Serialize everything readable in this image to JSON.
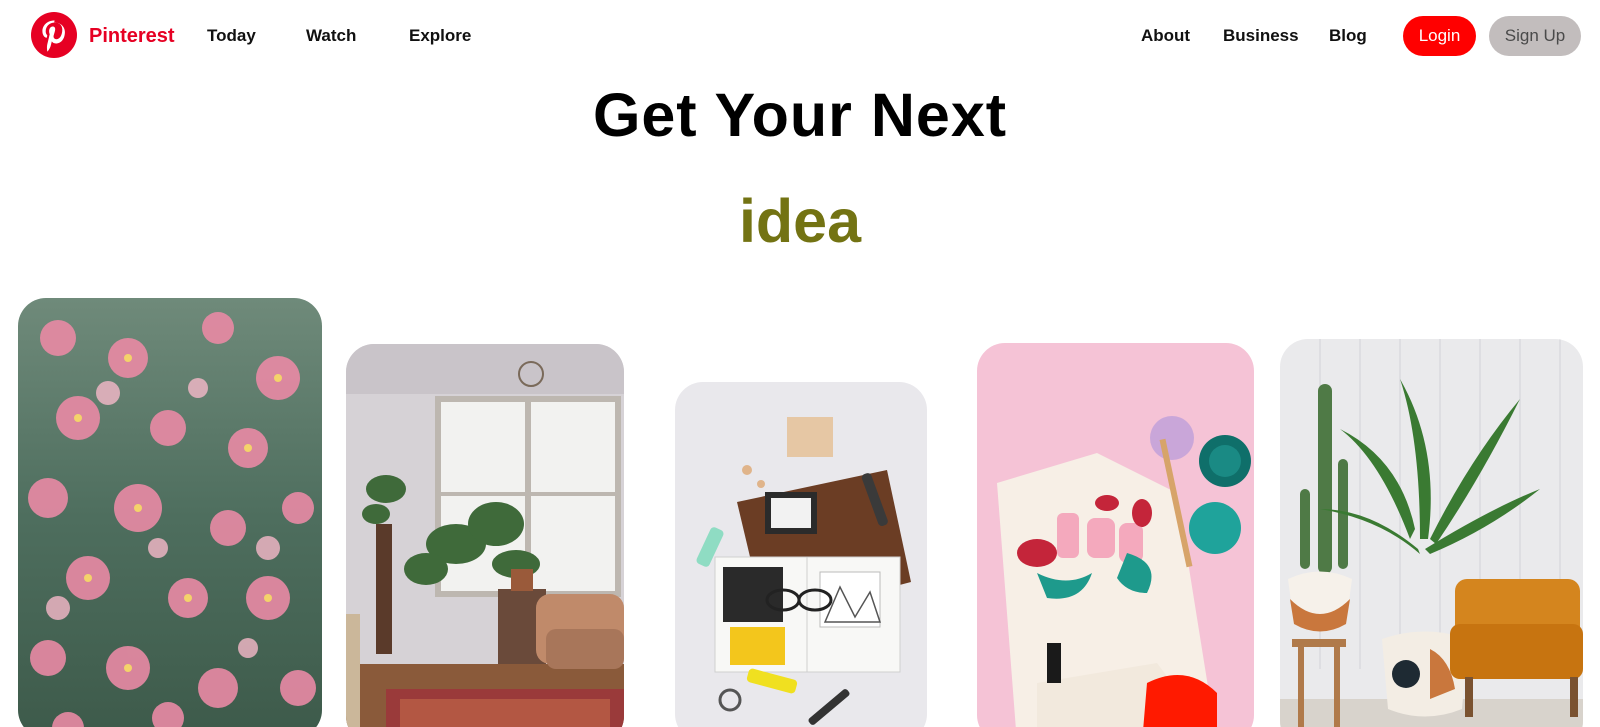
{
  "header": {
    "brand": "Pinterest",
    "logo_icon": "pinterest-logo-icon",
    "nav_left": [
      "Today",
      "Watch",
      "Explore"
    ],
    "nav_right": [
      "About",
      "Business",
      "Blog"
    ],
    "login_label": "Login",
    "signup_label": "Sign Up"
  },
  "hero": {
    "title": "Get Your Next",
    "word": "idea"
  },
  "cards": [
    {
      "subject": "pink-flowers-image"
    },
    {
      "subject": "living-room-plants-image"
    },
    {
      "subject": "journal-stationery-image"
    },
    {
      "subject": "painted-tshirt-image"
    },
    {
      "subject": "plants-orange-sofa-image"
    }
  ],
  "colors": {
    "brand": "#e60023",
    "login_bg": "#ff0000",
    "signup_bg": "#c2bdbd",
    "accent_word": "#737313"
  }
}
